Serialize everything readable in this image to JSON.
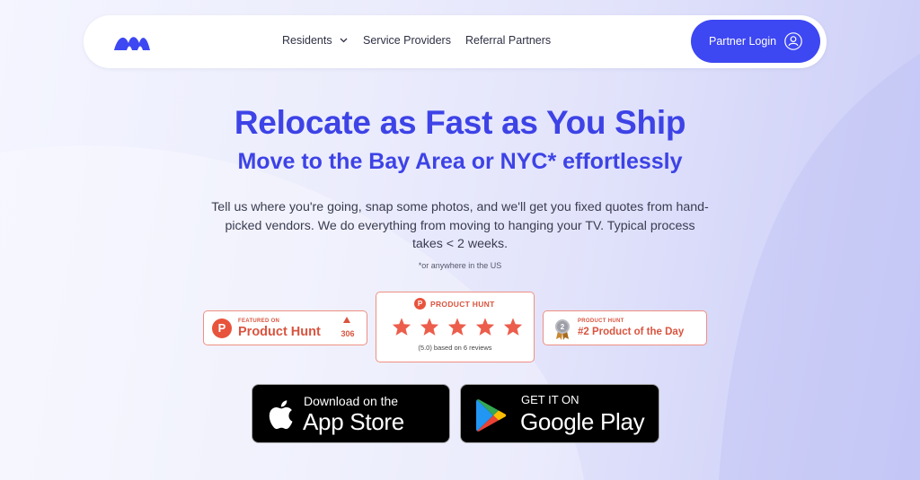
{
  "nav": {
    "items": [
      {
        "label": "Residents"
      },
      {
        "label": "Service Providers"
      },
      {
        "label": "Referral Partners"
      }
    ],
    "partner_login": "Partner Login"
  },
  "hero": {
    "title": "Relocate as Fast as You Ship",
    "subtitle": "Move to the Bay Area or NYC* effortlessly",
    "body": "Tell us where you're going, snap some photos, and we'll get you fixed quotes from hand-picked vendors. We do everything from moving to hanging your TV. Typical process takes < 2 weeks.",
    "note": "*or anywhere in the US"
  },
  "badges": {
    "featured": {
      "small": "FEATURED ON",
      "big": "Product Hunt",
      "count": "306"
    },
    "rating": {
      "label": "PRODUCT HUNT",
      "stars": 5,
      "reviews": "(5.0) based on 6 reviews"
    },
    "potd": {
      "small": "PRODUCT HUNT",
      "big": "#2 Product of the Day",
      "medal_number": "2"
    }
  },
  "stores": {
    "apple": {
      "small": "Download on the",
      "big": "App Store"
    },
    "google": {
      "small": "GET IT ON",
      "big": "Google Play"
    }
  },
  "colors": {
    "accent": "#3d47f2",
    "heading": "#3d43e6",
    "product_hunt": "#d9543f",
    "star": "#ec5d4b"
  }
}
